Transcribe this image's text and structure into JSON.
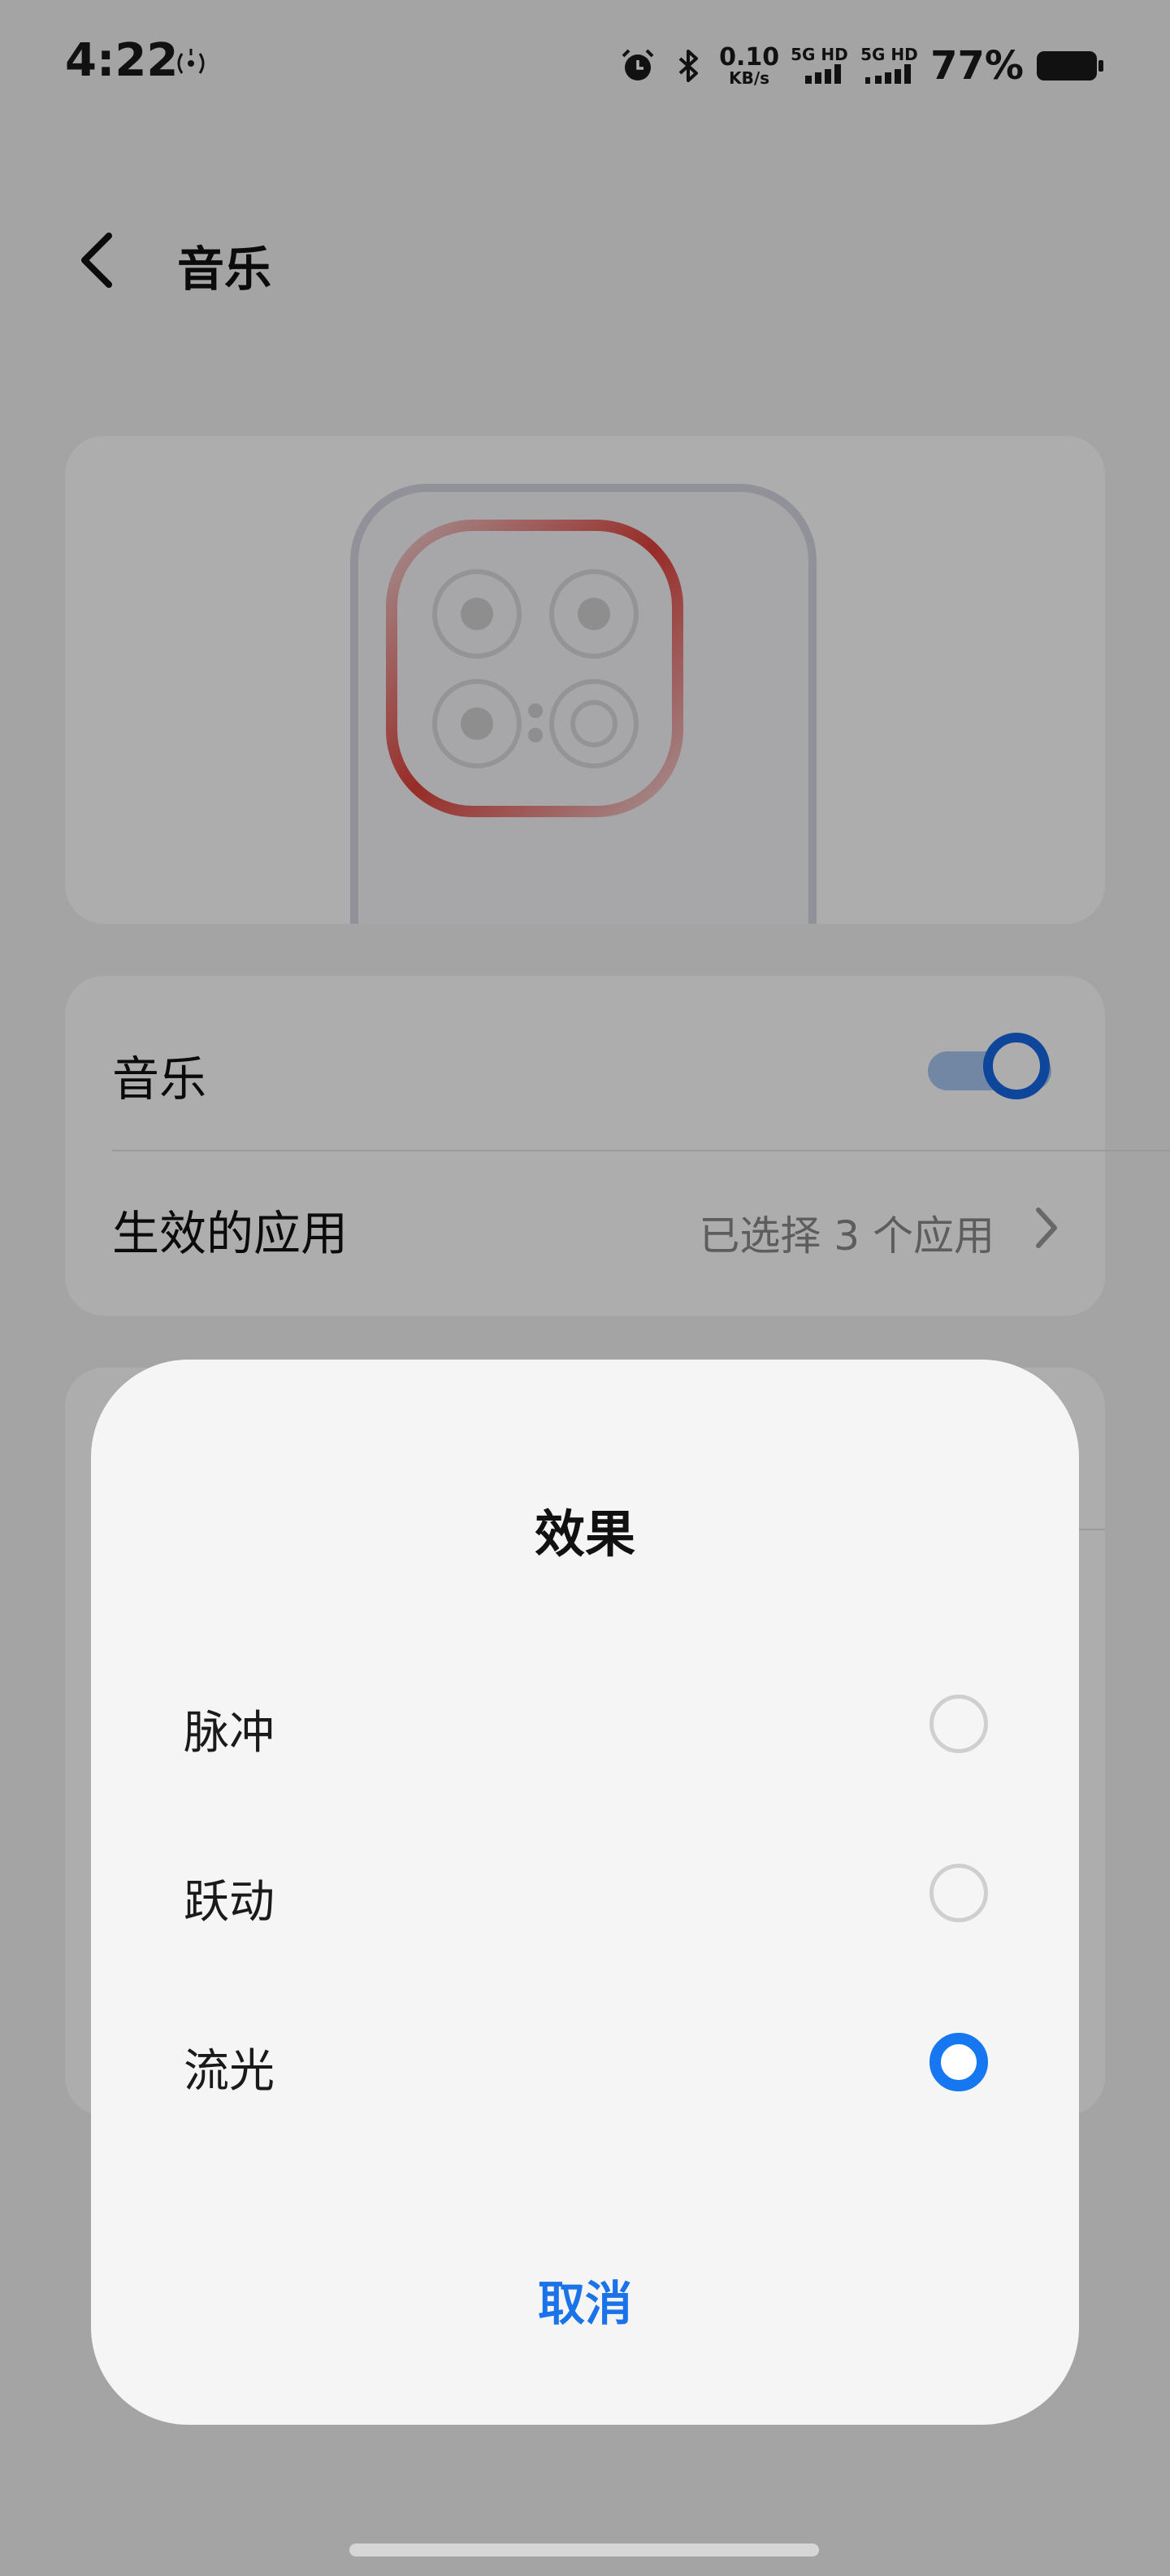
{
  "status_bar": {
    "time": "4:22",
    "net_speed_value": "0.10",
    "net_speed_unit": "KB/s",
    "sim1_label": "5G HD",
    "sim2_label": "5G HD",
    "battery_percent": "77%"
  },
  "header": {
    "title": "音乐"
  },
  "settings": {
    "music_toggle_label": "音乐",
    "music_toggle_on": true,
    "apps_label": "生效的应用",
    "apps_value": "已选择 3 个应用"
  },
  "dialog": {
    "title": "效果",
    "options": [
      {
        "label": "脉冲",
        "selected": false
      },
      {
        "label": "跃动",
        "selected": false
      },
      {
        "label": "流光",
        "selected": true
      }
    ],
    "cancel_label": "取消"
  },
  "colors": {
    "accent": "#1677f0",
    "cancel_text": "#1a73e8",
    "camera_glow": "#e0413a"
  }
}
